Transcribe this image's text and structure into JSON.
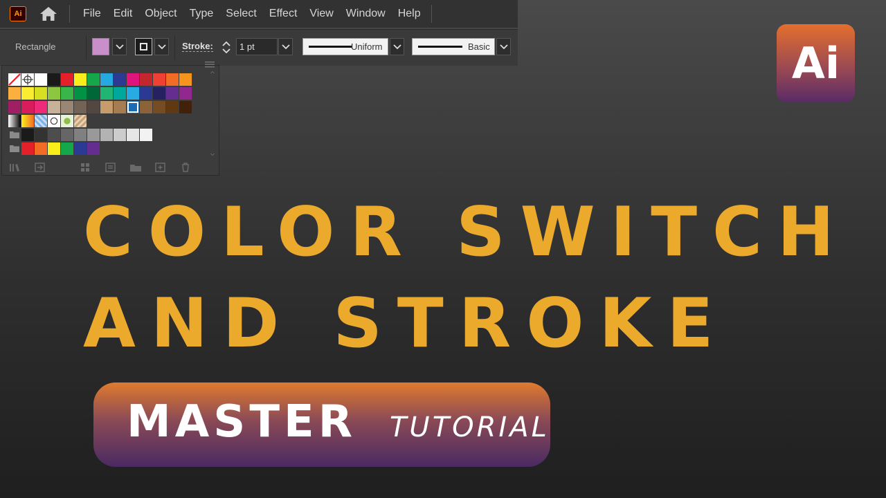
{
  "app": {
    "logo_text": "Ai",
    "menu": [
      "File",
      "Edit",
      "Object",
      "Type",
      "Select",
      "Effect",
      "View",
      "Window",
      "Help"
    ]
  },
  "control_bar": {
    "object_label": "Rectangle",
    "fill_color": "#c98fca",
    "stroke_label": "Stroke:",
    "stroke_weight": "1 pt",
    "variable_width": "Uniform",
    "brush": "Basic"
  },
  "swatches": {
    "rows": [
      [
        "none",
        "registration",
        "#ffffff",
        "#1a1a1a",
        "#e5202a",
        "#f9ee1c",
        "#15a84a",
        "#26a9e0",
        "#2b3a92",
        "#e0147b",
        "#c3262d",
        "#ef4035",
        "#f26c25",
        "#f7941e"
      ],
      [
        "#fbaf3f",
        "#f9ec31",
        "#d7df23",
        "#8dc63f",
        "#39b54a",
        "#009345",
        "#006838",
        "#21b573",
        "#00a79d",
        "#28aae2",
        "#2a3a92",
        "#262261",
        "#662d91",
        "#92278f"
      ],
      [
        "#9e1f63",
        "#d91c5c",
        "#ee2a7b",
        "#c7b299",
        "#998675",
        "#736357",
        "#534741",
        "#c69c6d",
        "#a67c52",
        "#1a6cb5",
        "#8c6239",
        "#754c24",
        "#603913",
        "#42210b"
      ],
      [
        "gradient-bw",
        "gradient-orange",
        "pattern-blue",
        "pattern-circle",
        "pattern-green",
        "pattern-brown"
      ],
      [
        "folder",
        "#1a1a1a",
        "#333333",
        "#4d4d4d",
        "#666666",
        "#808080",
        "#999999",
        "#b3b3b3",
        "#cccccc",
        "#e6e6e6",
        "#f2f2f2"
      ],
      [
        "folder",
        "#e5202a",
        "#f26c25",
        "#f9ee1c",
        "#15a84a",
        "#2b3a92",
        "#662d91"
      ]
    ],
    "selected": "#1a6cb5"
  },
  "title": {
    "line1": "COLOR SWITCH",
    "line2": "AND STROKE",
    "color": "#ecaa2c"
  },
  "badge": {
    "word1": "MASTER",
    "word2": "TUTORIAL"
  },
  "brand_logo": {
    "text": "Ai"
  }
}
